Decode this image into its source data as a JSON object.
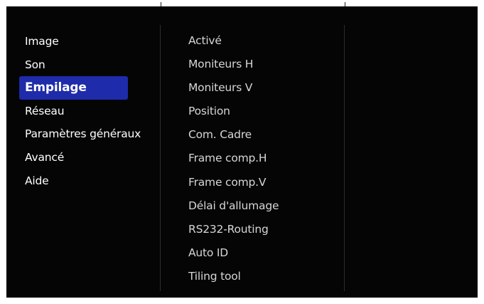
{
  "main_menu": {
    "items": [
      {
        "label": "Image"
      },
      {
        "label": "Son"
      },
      {
        "label": "Empilage"
      },
      {
        "label": "Réseau"
      },
      {
        "label": "Paramètres généraux"
      },
      {
        "label": "Avancé"
      },
      {
        "label": "Aide"
      }
    ],
    "selected": "Empilage"
  },
  "sub_menu": {
    "items": [
      {
        "label": "Activé"
      },
      {
        "label": "Moniteurs H"
      },
      {
        "label": "Moniteurs V"
      },
      {
        "label": "Position"
      },
      {
        "label": "Com. Cadre"
      },
      {
        "label": "Frame comp.H"
      },
      {
        "label": "Frame comp.V"
      },
      {
        "label": "Délai d'allumage"
      },
      {
        "label": "RS232-Routing"
      },
      {
        "label": "Auto ID"
      },
      {
        "label": "Tiling tool"
      }
    ]
  },
  "colors": {
    "background": "#050505",
    "highlight": "#1e2baa",
    "text": "#ffffff",
    "submenu_text": "#d6d6d6"
  }
}
